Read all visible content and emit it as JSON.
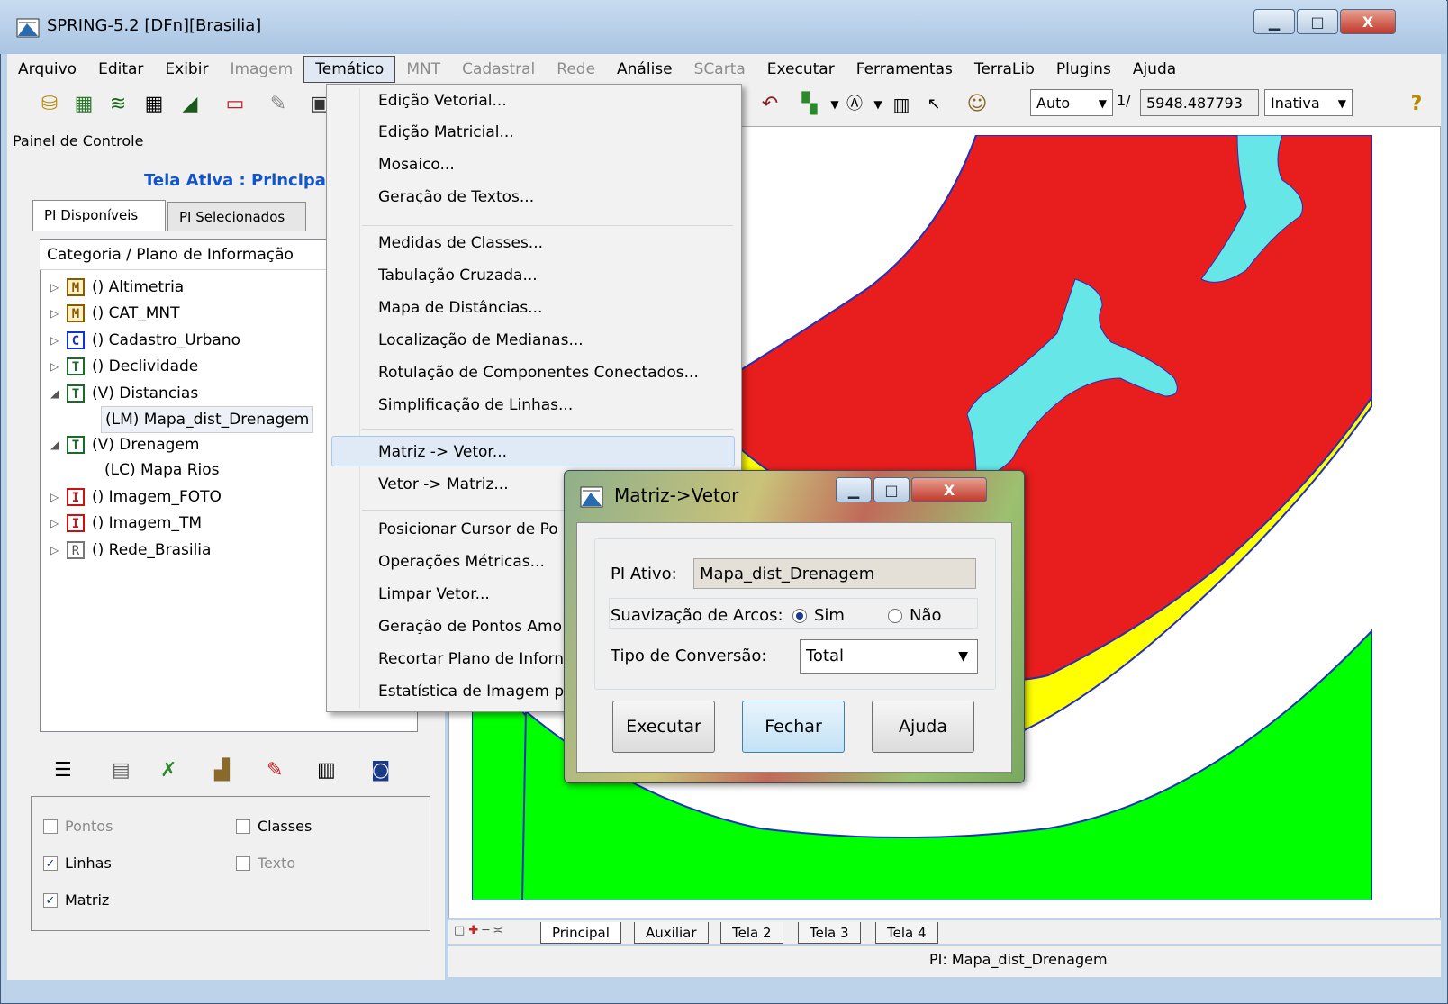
{
  "window": {
    "title": "SPRING-5.2 [DFn][Brasilia]",
    "minimize_glyph": "▁",
    "maximize_glyph": "□",
    "close_glyph": "X"
  },
  "menubar": {
    "items": [
      {
        "label": "Arquivo",
        "enabled": true
      },
      {
        "label": "Editar",
        "enabled": true
      },
      {
        "label": "Exibir",
        "enabled": true
      },
      {
        "label": "Imagem",
        "enabled": false
      },
      {
        "label": "Temático",
        "enabled": true,
        "active": true
      },
      {
        "label": "MNT",
        "enabled": false
      },
      {
        "label": "Cadastral",
        "enabled": false
      },
      {
        "label": "Rede",
        "enabled": false
      },
      {
        "label": "Análise",
        "enabled": true
      },
      {
        "label": "SCarta",
        "enabled": false
      },
      {
        "label": "Executar",
        "enabled": true
      },
      {
        "label": "Ferramentas",
        "enabled": true
      },
      {
        "label": "TerraLib",
        "enabled": true
      },
      {
        "label": "Plugins",
        "enabled": true
      },
      {
        "label": "Ajuda",
        "enabled": true
      }
    ]
  },
  "toolbar": {
    "scale_mode": "Auto",
    "scale_prefix": "1/",
    "scale_value": "5948.487793",
    "state": "Inativa",
    "help_glyph": "?",
    "icons": [
      "database-icon",
      "image-stack-icon",
      "layers-icon",
      "grid-icon",
      "polygon-icon",
      "rectangle-icon",
      "pin-icon",
      "user-icon"
    ],
    "right_icons": [
      "undo-arrow-icon",
      "paint-icon",
      "chevron-down",
      "sample-icon",
      "chevron-down",
      "histogram-icon",
      "cursor-plus-icon",
      "palette-icon"
    ]
  },
  "left_panel": {
    "title": "Painel de Controle",
    "active_screen": "Tela Ativa : Principal",
    "tabs": [
      "PI Disponíveis",
      "PI Selecionados"
    ],
    "tree_header": "Categoria / Plano de Informação",
    "tree": [
      {
        "badge": "M",
        "label": "() Altimetria",
        "expanded": false
      },
      {
        "badge": "M",
        "label": "() CAT_MNT",
        "expanded": false
      },
      {
        "badge": "C",
        "label": "() Cadastro_Urbano",
        "expanded": false
      },
      {
        "badge": "T",
        "label": "() Declividade",
        "expanded": false
      },
      {
        "badge": "T",
        "label": "(V) Distancias",
        "expanded": true,
        "children": [
          "(LM) Mapa_dist_Drenagem"
        ]
      },
      {
        "badge": "T",
        "label": "(V) Drenagem",
        "expanded": true,
        "children": [
          "(LC) Mapa Rios"
        ]
      },
      {
        "badge": "I",
        "label": "() Imagem_FOTO",
        "expanded": false
      },
      {
        "badge": "I",
        "label": "() Imagem_TM",
        "expanded": false
      },
      {
        "badge": "R",
        "label": "() Rede_Brasilia",
        "expanded": false
      }
    ],
    "options": {
      "pontos": "Pontos",
      "classes": "Classes",
      "linhas": "Linhas",
      "texto": "Texto",
      "matriz": "Matriz"
    }
  },
  "dropdown_menu": {
    "items": [
      "Edição Vetorial...",
      "Edição Matricial...",
      "Mosaico...",
      "Geração de Textos...",
      "Medidas de Classes...",
      "Tabulação Cruzada...",
      "Mapa de Distâncias...",
      "Localização de Medianas...",
      "Rotulação de Componentes Conectados...",
      "Simplificação de Linhas...",
      "Matriz -> Vetor...",
      "Vetor -> Matriz...",
      "Posicionar Cursor de Po",
      "Operações Métricas...",
      "Limpar Vetor...",
      "Geração de Pontos Amo",
      "Recortar Plano de Inforn",
      "Estatística de Imagem p"
    ],
    "highlighted": "Matriz -> Vetor..."
  },
  "dialog": {
    "title": "Matriz->Vetor",
    "pi_label": "PI Ativo:",
    "pi_value": "Mapa_dist_Drenagem",
    "smooth_label": "Suavização de Arcos:",
    "smooth_yes": "Sim",
    "smooth_no": "Não",
    "smooth_selected": "Sim",
    "tipo_label": "Tipo de Conversão:",
    "tipo_value": "Total",
    "buttons": [
      "Executar",
      "Fechar",
      "Ajuda"
    ]
  },
  "map": {
    "colors": {
      "green": "#00ff00",
      "yellow": "#ffff00",
      "red": "#e81e1e",
      "cyan": "#66e6e6",
      "border": "#2030c0"
    }
  },
  "bottom_tabs": [
    "Principal",
    "Auxiliar",
    "Tela 2",
    "Tela 3",
    "Tela 4"
  ],
  "status": {
    "pi": "PI: Mapa_dist_Drenagem"
  }
}
